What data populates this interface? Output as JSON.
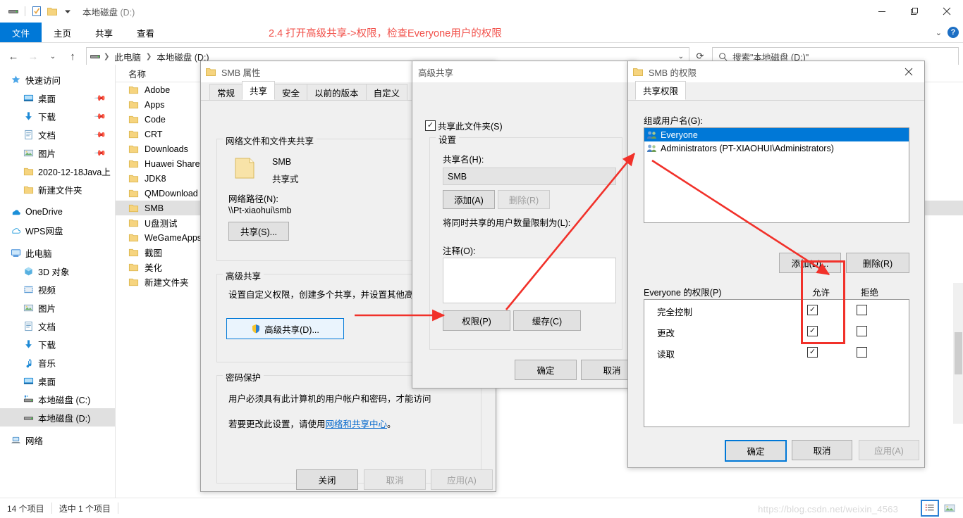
{
  "explorer": {
    "titlebar": {
      "title": "本地磁盘",
      "title_suffix": "(D:)",
      "quick_access_icons": [
        "drive-icon",
        "properties-icon",
        "new-folder-icon",
        "customize-chevron-icon"
      ],
      "minimize": "—",
      "maximize": "❐",
      "close": "✕"
    },
    "ribbon": {
      "tabs": [
        {
          "label": "文件",
          "active": true
        },
        {
          "label": "主页",
          "active": false
        },
        {
          "label": "共享",
          "active": false
        },
        {
          "label": "查看",
          "active": false
        }
      ],
      "help_label": "?"
    },
    "nav": {
      "back": "←",
      "forward": "→",
      "recent": "⌄",
      "up": "↑",
      "refresh": "⟳",
      "breadcrumbs": [
        "此电脑",
        "本地磁盘 (D:)"
      ],
      "search_placeholder": "搜索\"本地磁盘 (D:)\""
    },
    "sidebar": [
      {
        "label": "快速访问",
        "icon": "star-pin-icon",
        "indent": 0,
        "pinned": false
      },
      {
        "label": "桌面",
        "icon": "desktop-icon",
        "indent": 1,
        "pinned": true
      },
      {
        "label": "下载",
        "icon": "download-icon",
        "indent": 1,
        "pinned": true
      },
      {
        "label": "文档",
        "icon": "document-icon",
        "indent": 1,
        "pinned": true
      },
      {
        "label": "图片",
        "icon": "pictures-icon",
        "indent": 1,
        "pinned": true
      },
      {
        "label": "2020-12-18Java上",
        "icon": "folder-icon",
        "indent": 1,
        "pinned": false
      },
      {
        "label": "新建文件夹",
        "icon": "folder-icon",
        "indent": 1,
        "pinned": false
      },
      {
        "label": "OneDrive",
        "icon": "onedrive-icon",
        "indent": 0,
        "pinned": false
      },
      {
        "label": "WPS网盘",
        "icon": "wps-cloud-icon",
        "indent": 0,
        "pinned": false
      },
      {
        "label": "此电脑",
        "icon": "this-pc-icon",
        "indent": 0,
        "pinned": false
      },
      {
        "label": "3D 对象",
        "icon": "3d-objects-icon",
        "indent": 1,
        "pinned": false
      },
      {
        "label": "视频",
        "icon": "videos-icon",
        "indent": 1,
        "pinned": false
      },
      {
        "label": "图片",
        "icon": "pictures-icon",
        "indent": 1,
        "pinned": false
      },
      {
        "label": "文档",
        "icon": "document-icon",
        "indent": 1,
        "pinned": false
      },
      {
        "label": "下载",
        "icon": "download-icon",
        "indent": 1,
        "pinned": false
      },
      {
        "label": "音乐",
        "icon": "music-icon",
        "indent": 1,
        "pinned": false
      },
      {
        "label": "桌面",
        "icon": "desktop-icon",
        "indent": 1,
        "pinned": false
      },
      {
        "label": "本地磁盘 (C:)",
        "icon": "system-drive-icon",
        "indent": 1,
        "pinned": false
      },
      {
        "label": "本地磁盘 (D:)",
        "icon": "drive-icon",
        "indent": 1,
        "pinned": false,
        "selected": true
      },
      {
        "label": "网络",
        "icon": "network-icon",
        "indent": 0,
        "pinned": false
      }
    ],
    "filelist": {
      "column_header": "名称",
      "rows": [
        {
          "name": "Adobe",
          "selected": false
        },
        {
          "name": "Apps",
          "selected": false
        },
        {
          "name": "Code",
          "selected": false
        },
        {
          "name": "CRT",
          "selected": false
        },
        {
          "name": "Downloads",
          "selected": false
        },
        {
          "name": "Huawei Share",
          "selected": false
        },
        {
          "name": "JDK8",
          "selected": false
        },
        {
          "name": "QMDownload",
          "selected": false
        },
        {
          "name": "SMB",
          "selected": true
        },
        {
          "name": "U盘测试",
          "selected": false
        },
        {
          "name": "WeGameApps",
          "selected": false
        },
        {
          "name": "截图",
          "selected": false
        },
        {
          "name": "美化",
          "selected": false
        },
        {
          "name": "新建文件夹",
          "selected": false
        }
      ]
    },
    "statusbar": {
      "item_count": "14 个项目",
      "selection": "选中 1 个项目",
      "watermark": "https://blog.csdn.net/weixin_4563",
      "view_details_icon": "details-view-icon",
      "view_thumbs_icon": "large-icons-view-icon"
    }
  },
  "annotation": {
    "text": "2.4 打开高级共享->权限，检查Everyone用户的权限",
    "color": "#f1504a",
    "highlight_color": "#f1312a"
  },
  "props_dialog": {
    "title": "SMB 属性",
    "icon": "folder-icon",
    "tabs": [
      {
        "label": "常规",
        "active": false
      },
      {
        "label": "共享",
        "active": true
      },
      {
        "label": "安全",
        "active": false
      },
      {
        "label": "以前的版本",
        "active": false
      },
      {
        "label": "自定义",
        "active": false
      }
    ],
    "group_network": {
      "legend": "网络文件和文件夹共享",
      "folder_name": "SMB",
      "share_state": "共享式",
      "path_label": "网络路径(N):",
      "path_value": "\\\\Pt-xiaohui\\smb",
      "share_button": "共享(S)..."
    },
    "group_advanced": {
      "legend": "高级共享",
      "description": "设置自定义权限，创建多个共享，并设置其他高级共",
      "button": "高级共享(D)...",
      "shield_icon": "shield-icon"
    },
    "group_password": {
      "legend": "密码保护",
      "line1": "用户必须具有此计算机的用户帐户和密码，才能访问",
      "line2_pre": "若要更改此设置，请使用",
      "line2_link": "网络和共享中心",
      "line2_post": "。"
    },
    "buttons": {
      "close": "关闭",
      "cancel": "取消",
      "apply": "应用(A)"
    }
  },
  "advshare_dialog": {
    "title": "高级共享",
    "share_checkbox": {
      "label": "共享此文件夹(S)",
      "checked": true
    },
    "settings_legend": "设置",
    "share_name_label": "共享名(H):",
    "share_name_value": "SMB",
    "add_button": "添加(A)",
    "remove_button": "删除(R)",
    "limit_label": "将同时共享的用户数量限制为(L):",
    "comment_label": "注释(O):",
    "comment_value": "",
    "permissions_button": "权限(P)",
    "cache_button": "缓存(C)",
    "ok_button": "确定",
    "cancel_button": "取消"
  },
  "perm_dialog": {
    "title": "SMB 的权限",
    "icon": "folder-icon",
    "tab": "共享权限",
    "group_label": "组或用户名(G):",
    "principals": [
      {
        "name": "Everyone",
        "selected": true,
        "icon": "users-group-icon"
      },
      {
        "name": "Administrators (PT-XIAOHUI\\Administrators)",
        "selected": false,
        "icon": "users-group-icon"
      }
    ],
    "add_button": "添加(D)...",
    "remove_button": "删除(R)",
    "perm_header": "Everyone 的权限(P)",
    "col_allow": "允许",
    "col_deny": "拒绝",
    "permissions": [
      {
        "name": "完全控制",
        "allow": true,
        "deny": false
      },
      {
        "name": "更改",
        "allow": true,
        "deny": false
      },
      {
        "name": "读取",
        "allow": true,
        "deny": false
      }
    ],
    "ok_button": "确定",
    "cancel_button": "取消",
    "apply_button": "应用(A)"
  }
}
